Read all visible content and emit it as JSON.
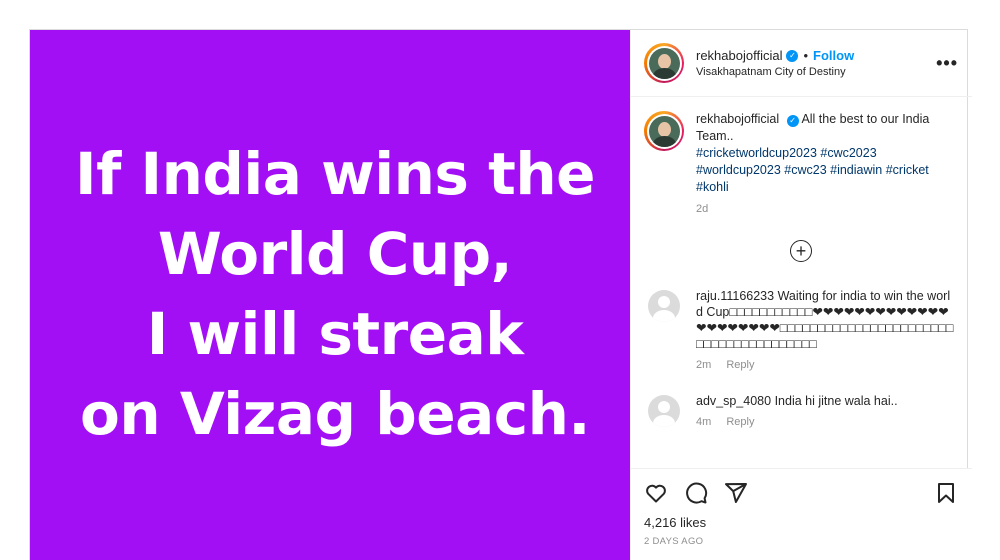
{
  "post": {
    "image_text": "If India wins the\nWorld Cup,\nI will streak\non Vizag beach.",
    "background_color": "#a30ff5"
  },
  "header": {
    "username": "rekhabojofficial",
    "separator": "•",
    "follow_label": "Follow",
    "location": "Visakhapatnam City of Destiny",
    "more_label": "•••"
  },
  "caption": {
    "username": "rekhabojofficial",
    "text": "All the best to our India Team..",
    "hashtags": "#cricketworldcup2023 #cwc2023 #worldcup2023 #cwc23 #indiawin #cricket #kohli",
    "time": "2d"
  },
  "load_more_label": "+",
  "comments": [
    {
      "username": "raju.11166233",
      "text": "Waiting for india to win the world Cup□□□□□□□□□□□❤❤❤❤❤❤❤❤❤❤❤❤❤❤❤❤❤❤❤❤❤□□□□□□□□□□□□□□□□□□□□□□□□□□□□□□□□□□□□□□□",
      "time": "2m",
      "reply_label": "Reply"
    },
    {
      "username": "adv_sp_4080",
      "text": "India hi jitne wala hai..",
      "time": "4m",
      "reply_label": "Reply"
    }
  ],
  "footer": {
    "likes": "4,216 likes",
    "date": "2 DAYS AGO"
  },
  "icons": [
    "heart-icon",
    "comment-icon",
    "share-icon",
    "bookmark-icon",
    "verified-icon",
    "add-circle-icon"
  ],
  "colors": {
    "accent": "#0095f6",
    "hashtag": "#00376b",
    "muted": "#8e8e8e"
  }
}
